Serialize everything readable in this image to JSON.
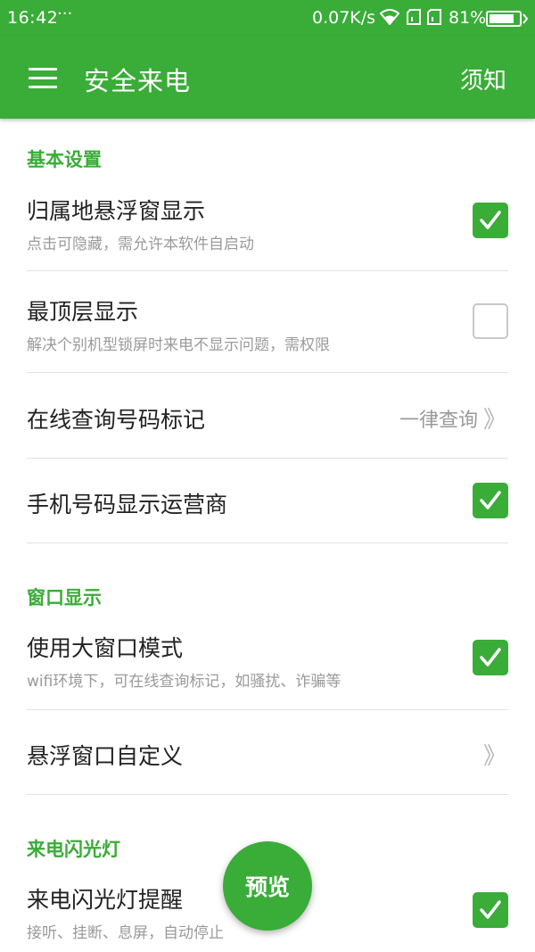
{
  "status_bar": {
    "time": "16:42",
    "overflow": "···",
    "net_speed": "0.07K/s",
    "battery_pct": "81%",
    "icons": [
      "wifi-icon",
      "sim-icon",
      "sim-icon",
      "battery-icon"
    ]
  },
  "app_bar": {
    "menu_icon": "hamburger-menu-icon",
    "title": "安全来电",
    "action": "须知"
  },
  "sections": [
    {
      "header": "基本设置",
      "items": [
        {
          "label": "归属地悬浮窗显示",
          "subtitle": "点击可隐藏，需允许本软件自启动",
          "checked": true
        },
        {
          "label": "最顶层显示",
          "subtitle": "解决个别机型锁屏时来电不显示问题，需权限",
          "checked": false
        },
        {
          "label": "在线查询号码标记",
          "value": "一律查询",
          "chevron": "》"
        },
        {
          "label": "手机号码显示运营商",
          "checked": true
        }
      ]
    },
    {
      "header": "窗口显示",
      "items": [
        {
          "label": "使用大窗口模式",
          "subtitle": "wifi环境下，可在线查询标记，如骚扰、诈骗等",
          "checked": true
        },
        {
          "label": "悬浮窗口自定义",
          "chevron": "》"
        }
      ]
    },
    {
      "header": "来电闪光灯",
      "items": [
        {
          "label": "来电闪光灯提醒",
          "subtitle": "接听、挂断、息屏，自动停止",
          "checked": true
        }
      ]
    }
  ],
  "fab": {
    "label": "预览"
  },
  "colors": {
    "accent": "#3aac38",
    "secondary_text": "#9a9a9a",
    "divider": "#e2e2e2"
  }
}
